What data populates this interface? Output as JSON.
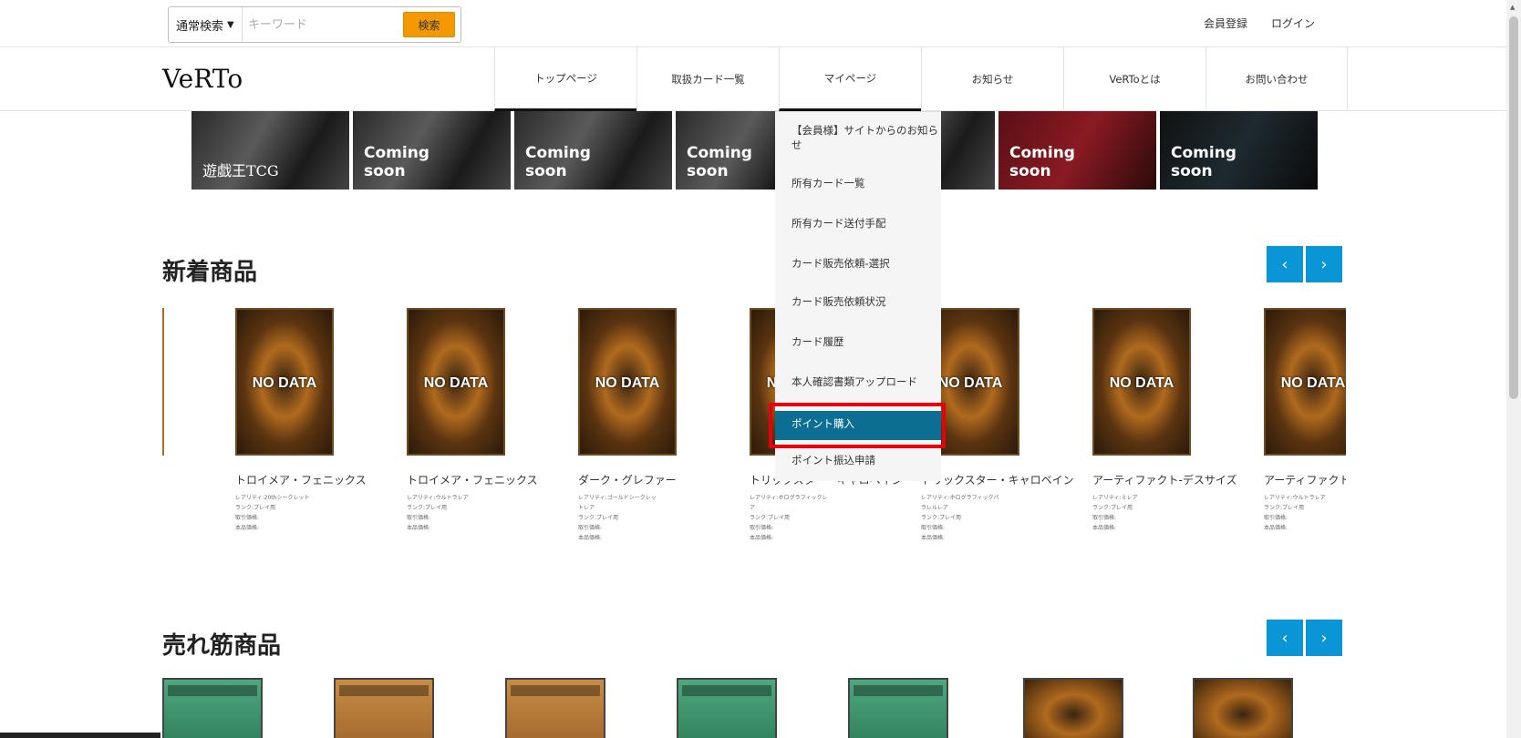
{
  "search": {
    "mode": "通常検索",
    "placeholder": "キーワード",
    "button": "検索"
  },
  "toplinks": {
    "register": "会員登録",
    "login": "ログイン"
  },
  "logo": "VeRTo",
  "nav": [
    "トップページ",
    "取扱カード一覧",
    "マイページ",
    "お知らせ",
    "VeRToとは",
    "お問い合わせ"
  ],
  "banners": [
    {
      "label": "遊戯王TCG"
    },
    {
      "label": "Coming\nsoon"
    },
    {
      "label": "Coming\nsoon"
    },
    {
      "label": "Coming\nsoon"
    },
    {
      "label": ""
    },
    {
      "label": "Coming\nsoon"
    },
    {
      "label": "Coming\nsoon"
    }
  ],
  "sections": {
    "new": "新着商品",
    "best": "売れ筋商品"
  },
  "pager": {
    "prev": "‹",
    "next": "›"
  },
  "products": [
    {
      "name": "トロイメア・フェニックス",
      "meta": [
        "レアリティ:20thシークレット",
        "ランク:プレイ用",
        "取引価格:",
        "本品価格:"
      ],
      "card": "NO DATA"
    },
    {
      "name": "トロイメア・フェニックス",
      "meta": [
        "レアリティ:ウルトラレア",
        "ランク:プレイ用",
        "取引価格:",
        "本品価格:"
      ],
      "card": "NO DATA"
    },
    {
      "name": "ダーク・グレファー",
      "meta": [
        "レアリティ:ゴールドシークレットレア",
        "ランク:プレイ用",
        "取引価格:",
        "本品価格:"
      ],
      "card": "NO DATA"
    },
    {
      "name": "トリックスター・キャロベイン",
      "meta": [
        "レアリティ:ホログラフィックレア",
        "ランク:プレイ用",
        "取引価格:",
        "本品価格:"
      ],
      "card": "NO DATA"
    },
    {
      "name": "トリックスター・キャロベイン",
      "meta": [
        "レアリティ:ホログラフィックパラレルレア",
        "ランク:プレイ用",
        "取引価格:",
        "本品価格:"
      ],
      "card": "NO DATA"
    },
    {
      "name": "アーティファクト-デスサイズ",
      "meta": [
        "レアリティ:ミレア",
        "ランク:プレイ用",
        "取引価格:",
        "本品価格:"
      ],
      "card": "NO DATA"
    },
    {
      "name": "アーティファクト-デスサイズ",
      "meta": [
        "レアリティ:ウルトラレア",
        "ランク:プレイ用",
        "取引価格:",
        "本品価格:"
      ],
      "card": "NO DATA"
    }
  ],
  "dropdown": [
    "【会員様】サイトからのお知らせ",
    "所有カード一覧",
    "所有カード送付手配",
    "カード販売依頼-選択",
    "カード販売依頼状況",
    "カード履歴",
    "本人確認書類アップロード",
    "ポイント購入",
    "ポイント振込申請"
  ]
}
